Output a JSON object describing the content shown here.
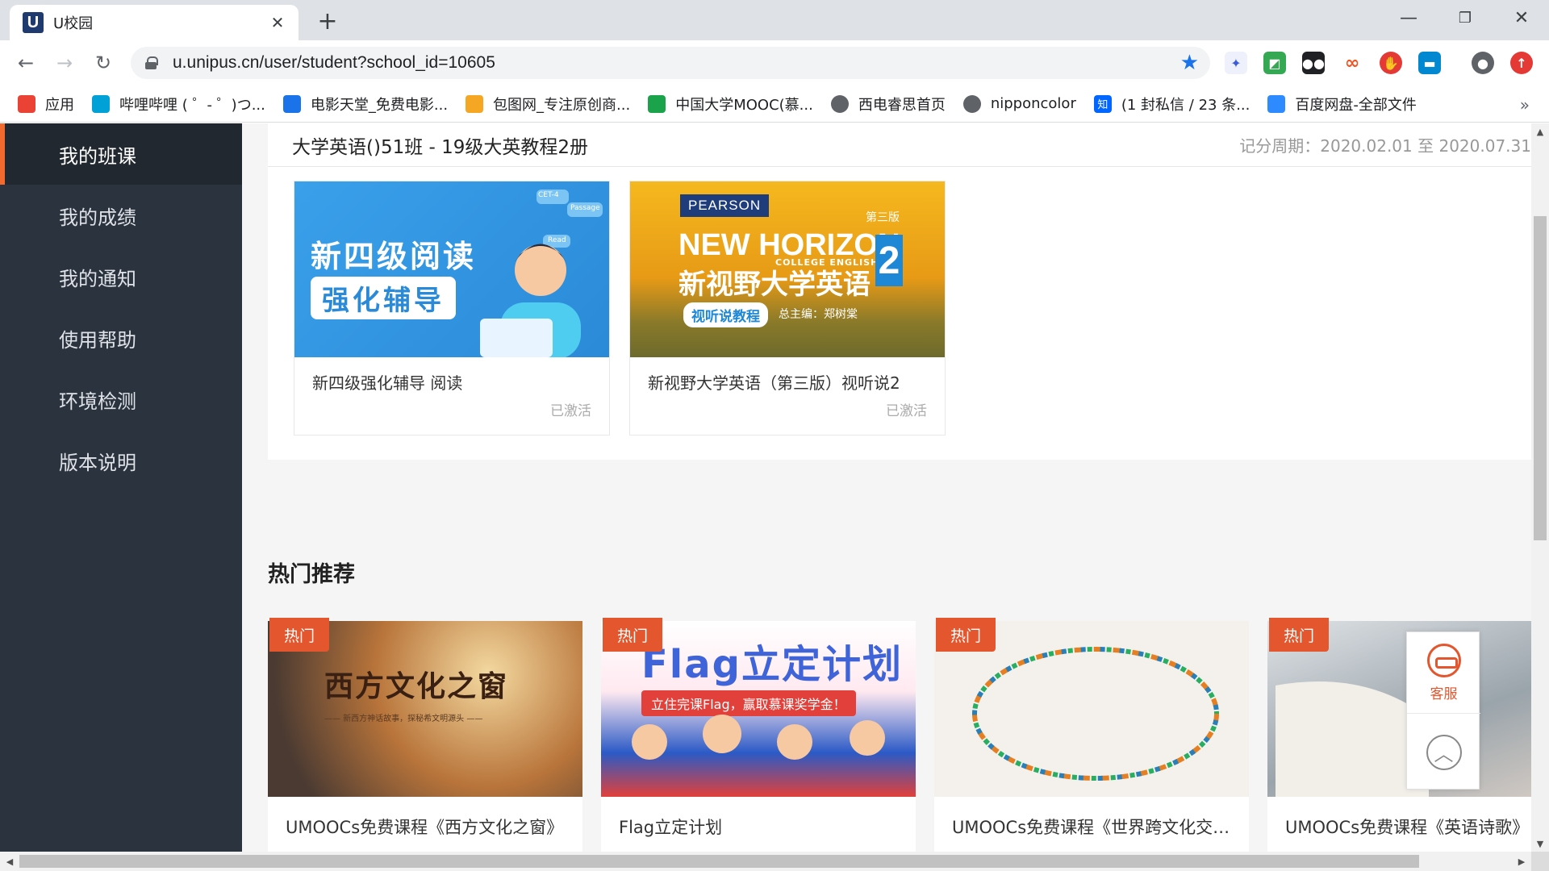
{
  "browser": {
    "tab_title": "U校园",
    "favicon_letter": "U",
    "url": "u.unipus.cn/user/student?school_id=10605",
    "bookmarks": [
      {
        "label": "应用",
        "icon": "apps-grid-icon",
        "color": "#ea4335"
      },
      {
        "label": "哔哩哔哩 ( ゜- ゜)つ...",
        "icon": "bilibili-icon",
        "color": "#00a1d6"
      },
      {
        "label": "电影天堂_免费电影...",
        "icon": "movie-icon",
        "color": "#1a73e8"
      },
      {
        "label": "包图网_专注原创商...",
        "icon": "baotu-icon",
        "color": "#f5a623"
      },
      {
        "label": "中国大学MOOC(慕...",
        "icon": "mooc-icon",
        "color": "#1aa34a"
      },
      {
        "label": "西电睿思首页",
        "icon": "globe-icon",
        "color": "#5f6368"
      },
      {
        "label": "nipponcolor",
        "icon": "globe-icon",
        "color": "#5f6368"
      },
      {
        "label": "(1 封私信 / 23 条...",
        "icon": "zhihu-icon",
        "color": "#0066ff",
        "glyph": "知"
      },
      {
        "label": "百度网盘-全部文件",
        "icon": "baidu-pan-icon",
        "color": "#2e8bff"
      }
    ],
    "more_glyph": "»"
  },
  "sidebar": {
    "items": [
      {
        "label": "我的班课",
        "active": true
      },
      {
        "label": "我的成绩",
        "active": false
      },
      {
        "label": "我的通知",
        "active": false
      },
      {
        "label": "使用帮助",
        "active": false
      },
      {
        "label": "环境检测",
        "active": false
      },
      {
        "label": "版本说明",
        "active": false
      }
    ],
    "accent_color": "#f26a2d"
  },
  "class_panel": {
    "title": "大学英语()51班 - 19级大英教程2册",
    "period": "记分周期：2020.02.01 至 2020.07.31",
    "courses": [
      {
        "name": "新四级强化辅导 阅读",
        "status": "已激活",
        "cover": {
          "line1": "新四级阅读",
          "line2": "强化辅导",
          "tag1": "CET-4",
          "tag2": "Passage",
          "tag3": "Read"
        }
      },
      {
        "name": "新视野大学英语（第三版）视听说2",
        "status": "已激活",
        "cover": {
          "brand": "PEARSON",
          "edition": "第三版",
          "series": "NEW HORIZON",
          "series_sub": "COLLEGE ENGLISH",
          "number": "2",
          "cn_title": "新视野大学英语",
          "badge": "视听说教程",
          "editor": "总主编：郑树棠"
        }
      }
    ]
  },
  "hot": {
    "title": "热门推荐",
    "badge_label": "热门",
    "items": [
      {
        "name": "UMOOCs免费课程《西方文化之窗》",
        "cover_text": "西方文化之窗",
        "cover_sub": "—— 新西方神话故事，探秘希文明源头 ——"
      },
      {
        "name": "Flag立定计划",
        "cover_text": "Flag立定计划",
        "cover_sub": "立住完课Flag，赢取慕课奖学金！"
      },
      {
        "name": "UMOOCs免费课程《世界跨文化交流》",
        "cover_text": "",
        "cover_sub": ""
      },
      {
        "name": "UMOOCs免费课程《英语诗歌》",
        "cover_text": "",
        "cover_sub": ""
      }
    ]
  },
  "float_panel": {
    "service_label": "客服"
  }
}
